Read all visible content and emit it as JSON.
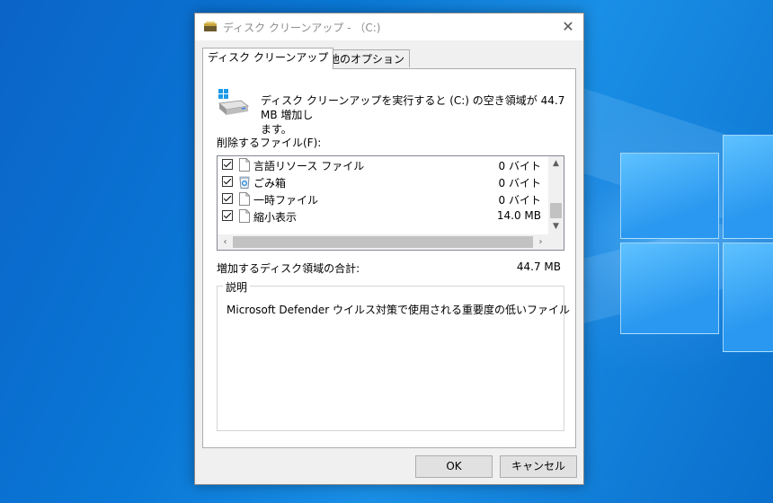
{
  "window": {
    "title": "ディスク クリーンアップ - （C:)"
  },
  "tabs": [
    {
      "label": "ディスク クリーンアップ"
    },
    {
      "label": "その他のオプション"
    }
  ],
  "summary": {
    "line1": "ディスク クリーンアップを実行すると (C:) の空き領域が 44.7 MB 増加し",
    "line2": "ます。"
  },
  "files": {
    "label": "削除するファイル(F):",
    "items": [
      {
        "name": "言語リソース ファイル",
        "size": "0 バイト",
        "checked": true,
        "icon": "file-icon"
      },
      {
        "name": "ごみ箱",
        "size": "0 バイト",
        "checked": true,
        "icon": "recycle-bin-icon"
      },
      {
        "name": "一時ファイル",
        "size": "0 バイト",
        "checked": true,
        "icon": "file-icon"
      },
      {
        "name": "縮小表示",
        "size": "14.0 MB",
        "checked": true,
        "icon": "file-icon"
      }
    ]
  },
  "total": {
    "label": "増加するディスク領域の合計:",
    "value": "44.7 MB"
  },
  "description": {
    "title": "説明",
    "text": "Microsoft Defender ウイルス対策で使用される重要度の低いファイル"
  },
  "buttons": {
    "ok": "OK",
    "cancel": "キャンセル"
  }
}
